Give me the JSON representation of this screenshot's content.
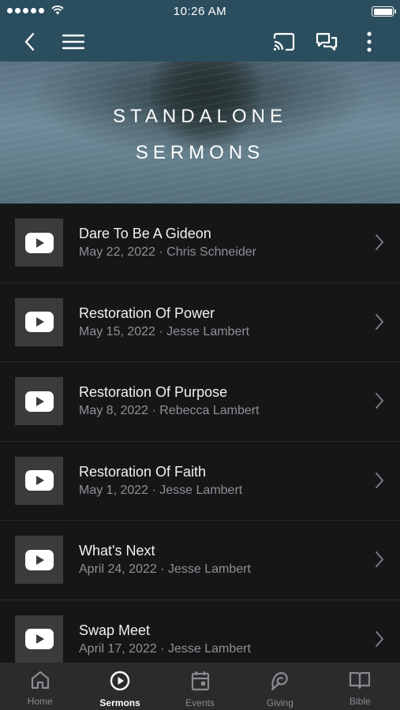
{
  "status": {
    "time": "10:26 AM"
  },
  "hero": {
    "line1": "STANDALONE",
    "line2": "SERMONS"
  },
  "sermons": [
    {
      "title": "Dare To Be A Gideon",
      "meta": "May 22, 2022 · Chris Schneider"
    },
    {
      "title": "Restoration Of Power",
      "meta": "May 15, 2022 · Jesse Lambert"
    },
    {
      "title": "Restoration Of Purpose",
      "meta": "May 8, 2022 · Rebecca Lambert"
    },
    {
      "title": "Restoration Of Faith",
      "meta": "May 1, 2022 · Jesse Lambert"
    },
    {
      "title": "What's Next",
      "meta": "April 24, 2022 · Jesse Lambert"
    },
    {
      "title": "Swap Meet",
      "meta": "April 17, 2022 · Jesse Lambert"
    }
  ],
  "tabs": [
    {
      "label": "Home",
      "icon": "home-icon"
    },
    {
      "label": "Sermons",
      "icon": "play-circle-icon",
      "active": true
    },
    {
      "label": "Events",
      "icon": "calendar-icon"
    },
    {
      "label": "Giving",
      "icon": "giving-icon"
    },
    {
      "label": "Bible",
      "icon": "book-icon"
    }
  ],
  "colors": {
    "header": "#2b4e5e",
    "background": "#151618",
    "tabbar": "#2a2b2d",
    "muted_text": "#8f9093"
  }
}
